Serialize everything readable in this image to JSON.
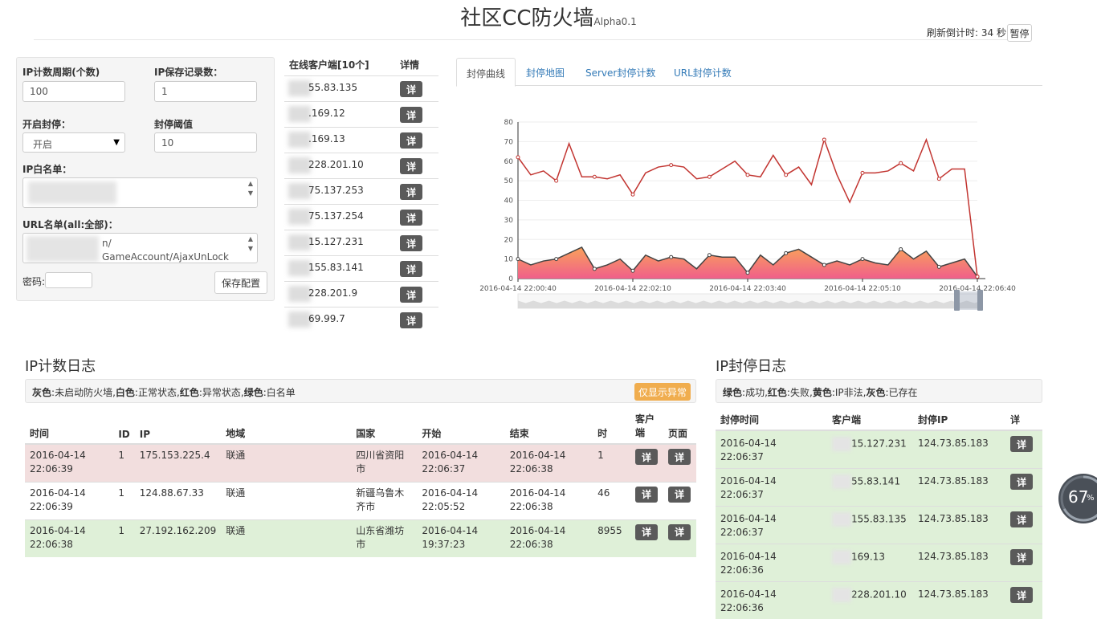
{
  "header": {
    "title": "社区CC防火墙",
    "version": "Alpha0.1",
    "countdown_label": "刷新倒计时:",
    "countdown_value": "34",
    "countdown_unit": "秒",
    "pause_label": "暂停"
  },
  "settings": {
    "ip_cycle_label": "IP计数周期(个数)",
    "ip_cycle_value": "100",
    "ip_keep_label": "IP保存记录数：",
    "ip_keep_value": "1",
    "block_enable_label": "开启封停：",
    "block_enable_value": "开启",
    "block_threshold_label": "封停阈值",
    "block_threshold_value": "10",
    "whitelist_label": "IP白名单：",
    "url_list_label": "URL名单(all:全部)：",
    "url_line1": "n/",
    "url_line2": "GameAccount/AjaxUnLock",
    "password_label": "密码:",
    "save_label": "保存配置"
  },
  "clients": {
    "header_clients": "在线客户端[10个]",
    "header_detail": "详情",
    "detail_label": "详",
    "items": [
      "55.83.135",
      ".169.12",
      ".169.13",
      "228.201.10",
      "75.137.253",
      "75.137.254",
      "15.127.231",
      "155.83.141",
      "228.201.9",
      "69.99.7"
    ]
  },
  "tabs": [
    "封停曲线",
    "封停地图",
    "Server封停计数",
    "URL封停计数"
  ],
  "chart_data": {
    "type": "area",
    "ylim": [
      0,
      80
    ],
    "yticks": [
      0,
      10,
      20,
      30,
      40,
      50,
      60,
      70,
      80
    ],
    "xtick_labels": [
      "2016-04-14 22:00:40",
      "2016-04-14 22:02:10",
      "2016-04-14 22:03:40",
      "2016-04-14 22:05:10",
      "2016-04-14 22:06:40"
    ],
    "series": [
      {
        "values": [
          62,
          53,
          55,
          50,
          69,
          52,
          52,
          51,
          53,
          43,
          54,
          57,
          58,
          57,
          51,
          52,
          56,
          60,
          53,
          52,
          63,
          53,
          57,
          48,
          71,
          53,
          39,
          54,
          54,
          55,
          59,
          55,
          71,
          51,
          56,
          56,
          1
        ],
        "color": "#c23531"
      },
      {
        "values": [
          10,
          7,
          9,
          10,
          13,
          16,
          5,
          7,
          10,
          4,
          12,
          9,
          11,
          10,
          5,
          12,
          11,
          11,
          3,
          12,
          7,
          13,
          15,
          11,
          7,
          9,
          7,
          10,
          8,
          7,
          15,
          10,
          14,
          6,
          8,
          10,
          1
        ],
        "color": "#f47b8a"
      }
    ]
  },
  "ip_log": {
    "title": "IP计数日志",
    "legend": [
      {
        "key": "灰色",
        "desc": "未启动防火墙"
      },
      {
        "key": "白色",
        "desc": "正常状态"
      },
      {
        "key": "红色",
        "desc": "异常状态"
      },
      {
        "key": "绿色",
        "desc": "白名单"
      }
    ],
    "only_abnormal_label": "仅显示异常",
    "columns": [
      "时间",
      "ID",
      "IP",
      "地域",
      "国家",
      "开始",
      "结束",
      "时",
      "客户端",
      "页面"
    ],
    "detail_label": "详",
    "rows": [
      {
        "status": "red",
        "time": "2016-04-14 22:06:39",
        "id": "1",
        "ip": "175.153.225.4",
        "region": "联通",
        "country": "四川省资阳市",
        "start": "2016-04-14 22:06:37",
        "end": "2016-04-14 22:06:38",
        "count": "1"
      },
      {
        "status": "white",
        "time": "2016-04-14 22:06:39",
        "id": "1",
        "ip": "124.88.67.33",
        "region": "联通",
        "country": "新疆乌鲁木齐市",
        "start": "2016-04-14 22:05:52",
        "end": "2016-04-14 22:06:38",
        "count": "46"
      },
      {
        "status": "green",
        "time": "2016-04-14 22:06:38",
        "id": "1",
        "ip": "27.192.162.209",
        "region": "联通",
        "country": "山东省潍坊市",
        "start": "2016-04-14 19:37:23",
        "end": "2016-04-14 22:06:38",
        "count": "8955"
      }
    ]
  },
  "block_log": {
    "title": "IP封停日志",
    "legend": [
      {
        "key": "绿色",
        "desc": "成功"
      },
      {
        "key": "红色",
        "desc": "失败"
      },
      {
        "key": "黄色",
        "desc": "IP非法"
      },
      {
        "key": "灰色",
        "desc": "已存在"
      }
    ],
    "columns": [
      "封停时间",
      "客户端",
      "封停IP",
      "详"
    ],
    "detail_label": "详",
    "rows": [
      {
        "time": "2016-04-14 22:06:37",
        "client": "15.127.231",
        "ip": "124.73.85.183"
      },
      {
        "time": "2016-04-14 22:06:37",
        "client": "55.83.141",
        "ip": "124.73.85.183"
      },
      {
        "time": "2016-04-14 22:06:37",
        "client": "155.83.135",
        "ip": "124.73.85.183"
      },
      {
        "time": "2016-04-14 22:06:36",
        "client": "169.13",
        "ip": "124.73.85.183"
      },
      {
        "time": "2016-04-14 22:06:36",
        "client": "228.201.10",
        "ip": "124.73.85.183"
      }
    ]
  },
  "progress": {
    "value": 67,
    "label": "67",
    "unit": "%"
  }
}
